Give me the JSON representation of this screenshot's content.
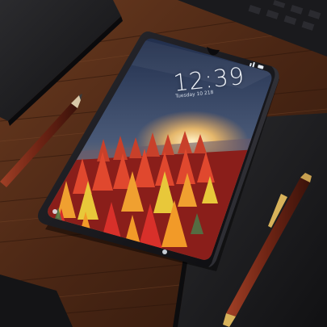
{
  "lock_screen": {
    "time": "12:39",
    "date": "Tuesday 10 218"
  },
  "objects": {
    "device": "smartphone",
    "surface": "wooden-desk",
    "items": [
      "notebook",
      "pen",
      "keyboard"
    ]
  },
  "colors": {
    "wood": "#5a321c",
    "phone_frame": "#15151a",
    "sky_top": "#2a3a5e",
    "sunset": "#f2b25a",
    "foliage_red": "#d83a2e",
    "foliage_orange": "#f09a2a",
    "foliage_yellow": "#e8c23a",
    "pen_body": "#7a2a1a",
    "notebook": "#1c1c1e"
  }
}
